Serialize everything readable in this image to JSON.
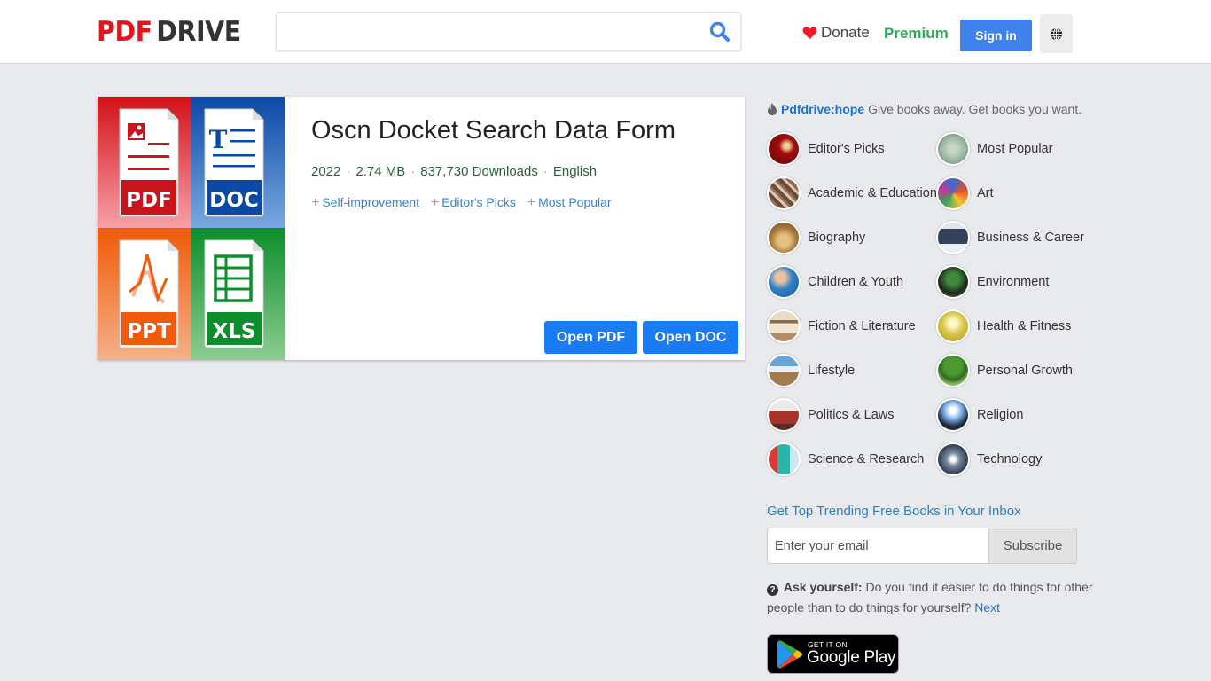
{
  "header": {
    "logo_part1": "PDF",
    "logo_part2": "DRIVE",
    "search": {
      "value": "",
      "placeholder": ""
    },
    "donate_label": "Donate",
    "premium_label": "Premium",
    "signin_label": "Sign in",
    "icons": {
      "search": "search-icon",
      "donate": "heart-icon",
      "language": "globe-icon"
    }
  },
  "book": {
    "title": "Oscn Docket Search Data Form",
    "year": "2022",
    "size": "2.74 MB",
    "downloads": "837,730 Downloads",
    "language": "English",
    "tags": [
      "Self-improvement",
      "Editor's Picks",
      "Most Popular"
    ],
    "cover_tiles": [
      "PDF",
      "DOC",
      "PPT",
      "XLS"
    ],
    "open_pdf_label": "Open PDF",
    "open_doc_label": "Open DOC"
  },
  "sidebar": {
    "hope_link": "Pdfdrive:hope",
    "hope_text": "Give books away. Get books you want.",
    "categories": [
      "Editor's Picks",
      "Most Popular",
      "Academic & Education",
      "Art",
      "Biography",
      "Business & Career",
      "Children & Youth",
      "Environment",
      "Fiction & Literature",
      "Health & Fitness",
      "Lifestyle",
      "Personal Growth",
      "Politics & Laws",
      "Religion",
      "Science & Research",
      "Technology"
    ],
    "newsletter_title": "Get Top Trending Free Books in Your Inbox",
    "email_placeholder": "Enter your email",
    "subscribe_label": "Subscribe",
    "ask_label": "Ask yourself:",
    "ask_text": "Do you find it easier to do things for other people than to do things for yourself?",
    "next_label": "Next",
    "gplay_small": "GET IT ON",
    "gplay_big": "Google Play"
  },
  "colors": {
    "brand_red": "#e3151e",
    "primary_blue": "#1a7cf2",
    "signin_blue": "#3f82ee",
    "premium_green": "#2eaa5c",
    "link_blue": "#1b73d9"
  }
}
